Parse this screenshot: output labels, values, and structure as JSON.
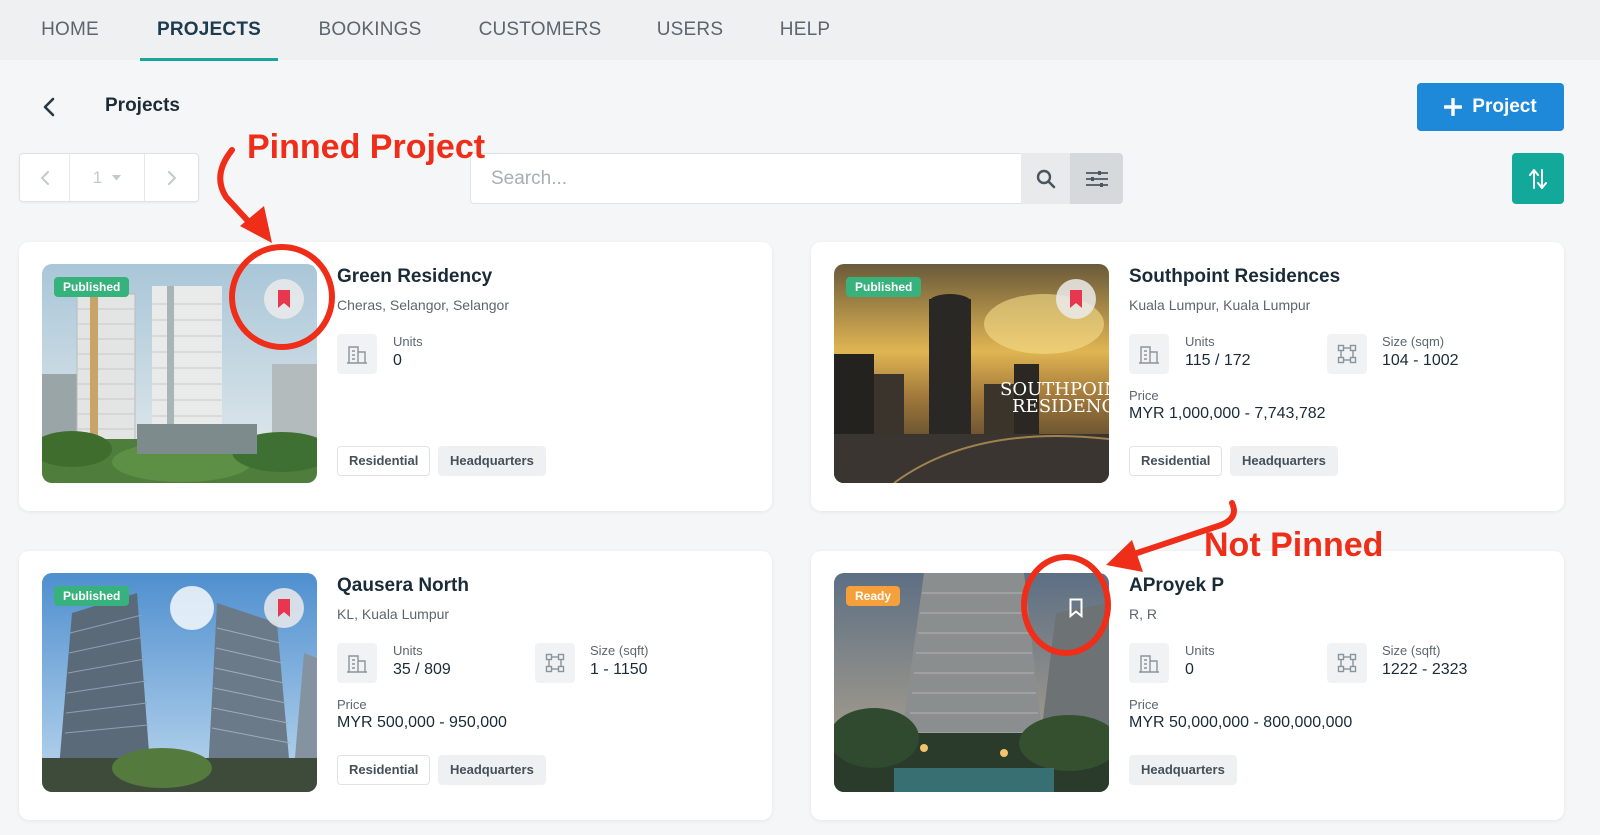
{
  "nav": {
    "items": [
      {
        "label": "HOME"
      },
      {
        "label": "PROJECTS"
      },
      {
        "label": "BOOKINGS"
      },
      {
        "label": "CUSTOMERS"
      },
      {
        "label": "USERS"
      },
      {
        "label": "HELP"
      }
    ],
    "active_index": 1
  },
  "header": {
    "title": "Projects",
    "add_button_label": "Project"
  },
  "pagination": {
    "current_page": "1"
  },
  "search": {
    "placeholder": "Search..."
  },
  "annotations": {
    "pinned": "Pinned Project",
    "not_pinned": "Not Pinned"
  },
  "projects": [
    {
      "name": "Green Residency",
      "location": "Cheras, Selangor, Selangor",
      "status": "Published",
      "pinned": true,
      "units_label": "Units",
      "units_value": "0",
      "tags": [
        "Residential",
        "Headquarters"
      ]
    },
    {
      "name": "Southpoint Residences",
      "location": "Kuala Lumpur, Kuala Lumpur",
      "status": "Published",
      "pinned": true,
      "units_label": "Units",
      "units_value": "115 / 172",
      "size_label": "Size (sqm)",
      "size_value": "104 - 1002",
      "price_label": "Price",
      "price_value": "MYR 1,000,000 - 7,743,782",
      "image_text_1": "SOUTHPOIN",
      "image_text_2": "RESIDENC",
      "tags": [
        "Residential",
        "Headquarters"
      ]
    },
    {
      "name": "Qausera North",
      "location": "KL, Kuala Lumpur",
      "status": "Published",
      "pinned": true,
      "units_label": "Units",
      "units_value": "35 / 809",
      "size_label": "Size (sqft)",
      "size_value": "1 - 1150",
      "price_label": "Price",
      "price_value": "MYR 500,000 - 950,000",
      "tags": [
        "Residential",
        "Headquarters"
      ]
    },
    {
      "name": "AProyek P",
      "location": "R, R",
      "status": "Ready",
      "pinned": false,
      "units_label": "Units",
      "units_value": "0",
      "size_label": "Size (sqft)",
      "size_value": "1222 - 2323",
      "price_label": "Price",
      "price_value": "MYR 50,000,000 - 800,000,000",
      "tags": [
        "Headquarters"
      ]
    }
  ],
  "colors": {
    "accent_teal": "#1aa59b",
    "primary_blue": "#1e88d9",
    "pin_red": "#e8364f",
    "annotation_red": "#ef2e1a",
    "badge_published": "#38b27c",
    "badge_ready": "#f5a03a"
  }
}
